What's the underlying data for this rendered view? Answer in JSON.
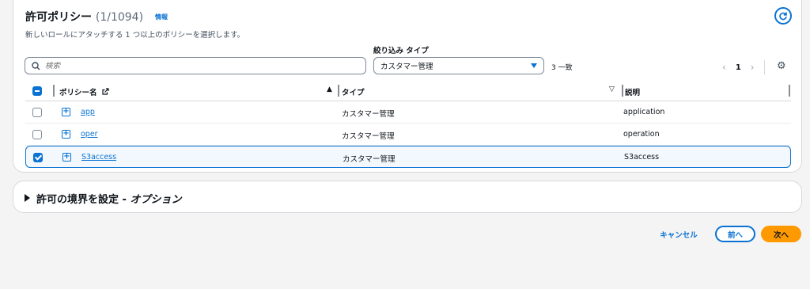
{
  "header": {
    "title": "許可ポリシー",
    "count": "(1/1094)",
    "info": "情報",
    "description": "新しいロールにアタッチする 1 つ以上のポリシーを選択します。"
  },
  "filter": {
    "label": "絞り込み タイプ",
    "search_placeholder": "検索",
    "selected_type": "カスタマー管理",
    "match_count": "3 一致"
  },
  "pagination": {
    "prev": "‹",
    "page": "1",
    "next": "›"
  },
  "table": {
    "columns": {
      "name": "ポリシー名",
      "type": "タイプ",
      "description": "説明"
    },
    "rows": [
      {
        "name": "app",
        "type": "カスタマー管理",
        "description": "application",
        "checked": false
      },
      {
        "name": "oper",
        "type": "カスタマー管理",
        "description": "operation",
        "checked": false
      },
      {
        "name": "S3access",
        "type": "カスタマー管理",
        "description": "S3access",
        "checked": true
      }
    ]
  },
  "boundary": {
    "title_main": "許可の境界を設定 - ",
    "title_opt": "オプション"
  },
  "footer": {
    "cancel": "キャンセル",
    "prev": "前へ",
    "next": "次へ"
  },
  "colors": {
    "accent": "#0972d3",
    "primary_button": "#ff9900",
    "selected_row_bg": "#f2f8fd"
  },
  "icons": {
    "refresh": "refresh-icon",
    "search": "search-icon",
    "settings": "gear-icon",
    "external": "external-link-icon"
  }
}
